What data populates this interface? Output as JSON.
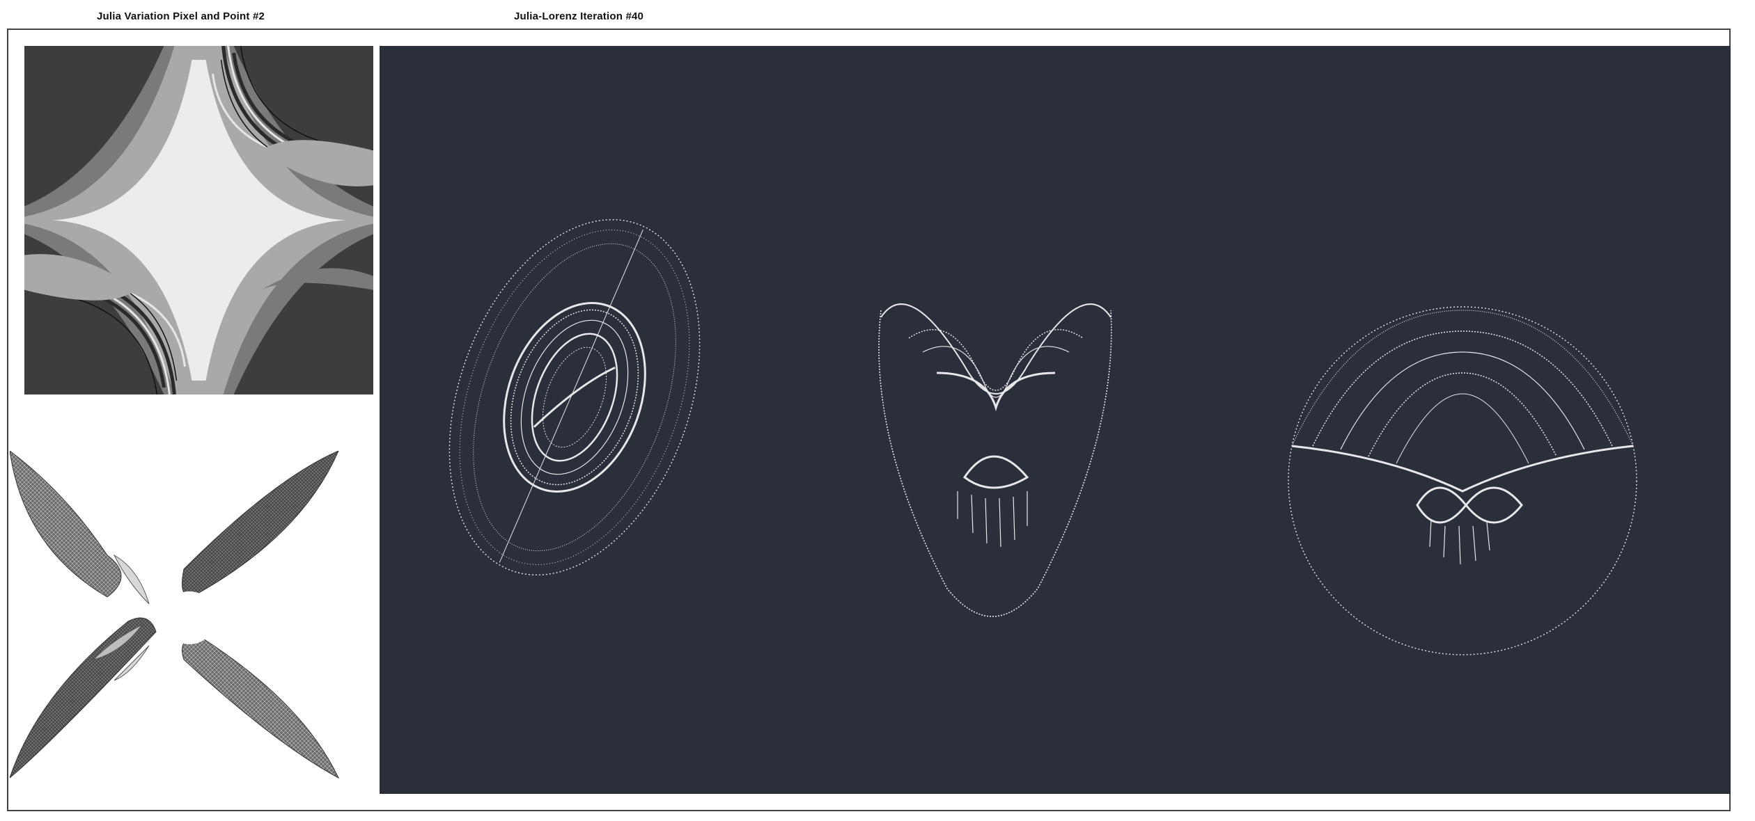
{
  "window": {
    "left_title": "Julia Variation Pixel and Point #2",
    "right_title": "Julia-Lorenz Iteration #40"
  },
  "colors": {
    "page_background": "#ffffff",
    "frame_border": "#444444",
    "julia_dark": "#3d3d3d",
    "julia_mid": "#7a7a7a",
    "julia_light": "#a9a9a9",
    "julia_lightest": "#ececec",
    "lorenz_background": "#2b2f3a",
    "lorenz_points": "#e8e8ea"
  },
  "panels": {
    "julia_fractal": "grayscale Julia set rendering (pixel mode)",
    "julia_flower": "four-petal Julia point cloud",
    "lorenz_attractors": "three Julia-Lorenz attractor point clouds"
  }
}
